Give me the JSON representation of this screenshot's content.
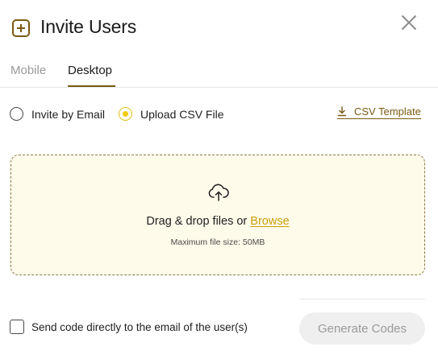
{
  "header": {
    "icon": "plus-square-icon",
    "title": "Invite Users",
    "close_icon": "close-icon"
  },
  "tabs": [
    {
      "label": "Mobile",
      "active": false
    },
    {
      "label": "Desktop",
      "active": true
    }
  ],
  "invite_method": {
    "options": [
      {
        "label": "Invite by Email",
        "selected": false
      },
      {
        "label": "Upload CSV File",
        "selected": true
      }
    ],
    "csv_template_link": "CSV Template",
    "csv_template_icon": "download-icon"
  },
  "dropzone": {
    "icon": "cloud-upload-icon",
    "text": "Drag & drop files or ",
    "browse_label": "Browse",
    "hint": "Maximum file size: 50MB"
  },
  "footer": {
    "send_email_label": "Send code directly to the email of the user(s)",
    "send_email_checked": false,
    "generate_button": "Generate Codes"
  },
  "colors": {
    "accent": "#7a5a12",
    "radio_selected": "#f2cb12",
    "browse_link": "#c99d0b",
    "dropzone_bg": "#fffbea",
    "disabled_button_bg": "#efefef"
  }
}
